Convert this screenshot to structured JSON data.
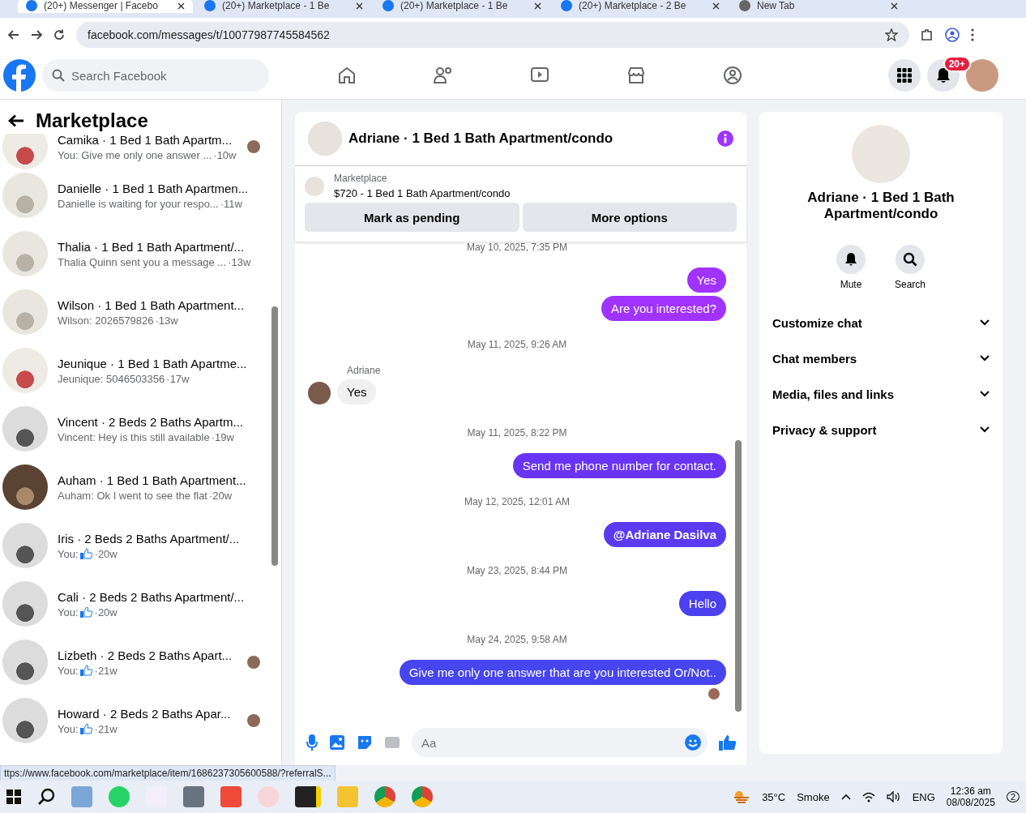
{
  "browser": {
    "tabs": [
      {
        "title": "(20+) Messenger | Facebo",
        "selected": true
      },
      {
        "title": "(20+) Marketplace - 1 Be",
        "selected": false
      },
      {
        "title": "(20+) Marketplace - 1 Be",
        "selected": false
      },
      {
        "title": "(20+) Marketplace - 2 Be",
        "selected": false
      },
      {
        "title": "New Tab",
        "selected": false
      }
    ],
    "url": "facebook.com/messages/t/10077987745584562"
  },
  "fb_nav": {
    "search_placeholder": "Search Facebook",
    "notification_badge": "20+"
  },
  "sidebar": {
    "title": "Marketplace",
    "conversations": [
      {
        "title": "Camika · 1 Bed 1 Bath Apartm...",
        "kind": "text",
        "preview": "You: Give me only one answer ...",
        "time": " ·10w",
        "seen": true
      },
      {
        "title": "Danielle · 1 Bed 1 Bath Apartmen...",
        "kind": "text",
        "preview": "Danielle is waiting for your respo...",
        "time": " ·11w",
        "seen": false
      },
      {
        "title": "Thalia · 1 Bed 1 Bath Apartment/...",
        "kind": "text",
        "preview": "Thalia Quinn sent you a message ...",
        "time": " ·13w",
        "seen": false
      },
      {
        "title": "Wilson · 1 Bed 1 Bath Apartment...",
        "kind": "text",
        "preview": "Wilson: 2026579826",
        "time": "·13w",
        "seen": false
      },
      {
        "title": "Jeunique · 1 Bed 1 Bath Apartme...",
        "kind": "text",
        "preview": "Jeunique: 5046503356",
        "time": "·17w",
        "seen": false
      },
      {
        "title": "Vincent · 2 Beds 2 Baths Apartm...",
        "kind": "text",
        "preview": "Vincent: Hey is this still available",
        "time": "·19w",
        "seen": false
      },
      {
        "title": "Auham · 1 Bed 1 Bath Apartment...",
        "kind": "text",
        "preview": "Auham: Ok I went to see the flat",
        "time": "·20w",
        "seen": false
      },
      {
        "title": "Iris · 2 Beds 2 Baths Apartment/...",
        "kind": "like",
        "preview": "You:",
        "time": "·20w",
        "seen": false
      },
      {
        "title": "Cali · 2 Beds 2 Baths Apartment/...",
        "kind": "like",
        "preview": "You:",
        "time": "·20w",
        "seen": false
      },
      {
        "title": "Lizbeth · 2 Beds 2 Baths Apart...",
        "kind": "like",
        "preview": "You:",
        "time": "·21w",
        "seen": true
      },
      {
        "title": "Howard · 2 Beds 2 Baths Apar...",
        "kind": "like",
        "preview": "You:",
        "time": "·21w",
        "seen": true
      }
    ]
  },
  "chat": {
    "title": "Adriane · 1 Bed 1 Bath Apartment/condo",
    "listing": {
      "label": "Marketplace",
      "text": "$720 - 1 Bed 1 Bath Apartment/condo"
    },
    "buttons": [
      "Mark as pending",
      "More options"
    ],
    "messages": [
      {
        "kind": "timestamp",
        "text": "May 10, 2025, 7:35 PM"
      },
      {
        "kind": "outgoing",
        "text": "Yes",
        "color": "#a033ff",
        "bold": false,
        "read": false
      },
      {
        "kind": "outgoing",
        "text": "Are you interested?",
        "color": "#a033ff",
        "bold": false,
        "read": false
      },
      {
        "kind": "timestamp",
        "text": "May 11, 2025, 9:26 AM"
      },
      {
        "kind": "incoming",
        "sender": "Adriane",
        "text": "Yes"
      },
      {
        "kind": "timestamp",
        "text": "May 11, 2025, 8:22 PM"
      },
      {
        "kind": "outgoing",
        "text": "Send me phone number for contact.",
        "color": "#6a34f5",
        "bold": false,
        "read": false
      },
      {
        "kind": "timestamp",
        "text": "May 12, 2025, 12:01 AM"
      },
      {
        "kind": "outgoing",
        "text": "@Adriane Dasilva",
        "color": "#5a3bf2",
        "bold": true,
        "read": false
      },
      {
        "kind": "timestamp",
        "text": "May 23, 2025, 8:44 PM"
      },
      {
        "kind": "outgoing",
        "text": "Hello",
        "color": "#4c40ef",
        "bold": false,
        "read": false
      },
      {
        "kind": "timestamp",
        "text": "May 24, 2025, 9:58 AM"
      },
      {
        "kind": "outgoing",
        "text": "Give me only one answer that are you interested Or/Not..",
        "color": "#4745ee",
        "bold": false,
        "read": true
      }
    ],
    "composer_placeholder": "Aa"
  },
  "details": {
    "title": "Adriane · 1 Bed 1 Bath Apartment/condo",
    "actions": [
      {
        "kind": "bell",
        "label": "Mute"
      },
      {
        "kind": "search",
        "label": "Search"
      }
    ],
    "sections": [
      {
        "label": "Customize chat",
        "expanded": false
      },
      {
        "label": "Chat members",
        "expanded": false
      },
      {
        "label": "Media, files and links",
        "expanded": false
      },
      {
        "label": "Privacy & support",
        "expanded": false
      }
    ]
  },
  "status_url": "ttps://www.facebook.com/marketplace/item/1686237305600588/?referralS...",
  "taskbar": {
    "temperature": "35°C",
    "weather": "Smoke",
    "language": "ENG",
    "time": "12:36 am",
    "date": "08/08/2025",
    "notifications": "2"
  }
}
